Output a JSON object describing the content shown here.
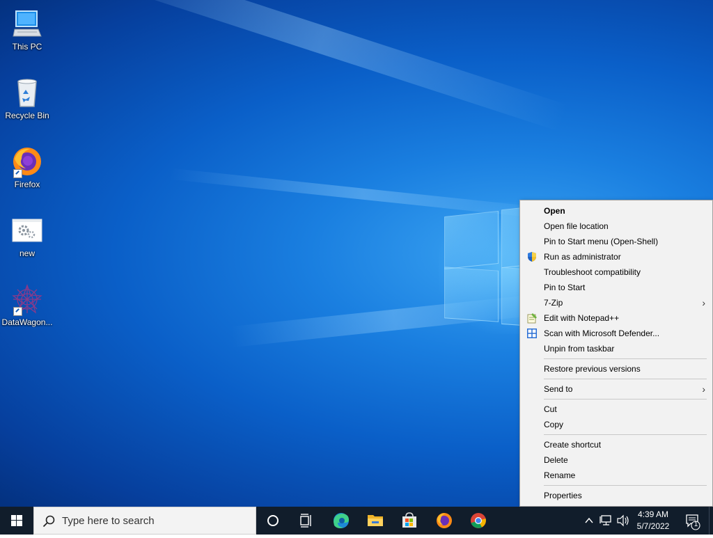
{
  "desktop": {
    "icons": [
      {
        "label": "This PC"
      },
      {
        "label": "Recycle Bin"
      },
      {
        "label": "Firefox"
      },
      {
        "label": "new"
      },
      {
        "label": "DataWagon..."
      }
    ]
  },
  "context_menu": {
    "items": [
      {
        "label": "Open",
        "bold": true
      },
      {
        "label": "Open file location"
      },
      {
        "label": "Pin to Start menu (Open-Shell)"
      },
      {
        "label": "Run as administrator",
        "icon": "uac-shield-icon"
      },
      {
        "label": "Troubleshoot compatibility"
      },
      {
        "label": "Pin to Start"
      },
      {
        "label": "7-Zip",
        "submenu": true
      },
      {
        "label": "Edit with Notepad++",
        "icon": "notepadpp-icon"
      },
      {
        "label": "Scan with Microsoft Defender...",
        "icon": "defender-icon"
      },
      {
        "label": "Unpin from taskbar"
      },
      {
        "label": "Restore previous versions"
      },
      {
        "label": "Send to",
        "submenu": true
      },
      {
        "label": "Cut"
      },
      {
        "label": "Copy"
      },
      {
        "label": "Create shortcut"
      },
      {
        "label": "Delete"
      },
      {
        "label": "Rename"
      },
      {
        "label": "Properties"
      }
    ]
  },
  "taskbar": {
    "search_placeholder": "Type here to search",
    "pinned": [
      "cortana-icon",
      "task-view-icon",
      "edge-icon",
      "file-explorer-icon",
      "store-icon",
      "firefox-icon",
      "chrome-icon"
    ],
    "clock_time": "4:39 AM",
    "clock_date": "5/7/2022",
    "notification_count": "1"
  },
  "colors": {
    "taskbar": "#111d2b",
    "menu_bg": "#f2f2f2",
    "desktop_blue": "#0a5fc8"
  }
}
